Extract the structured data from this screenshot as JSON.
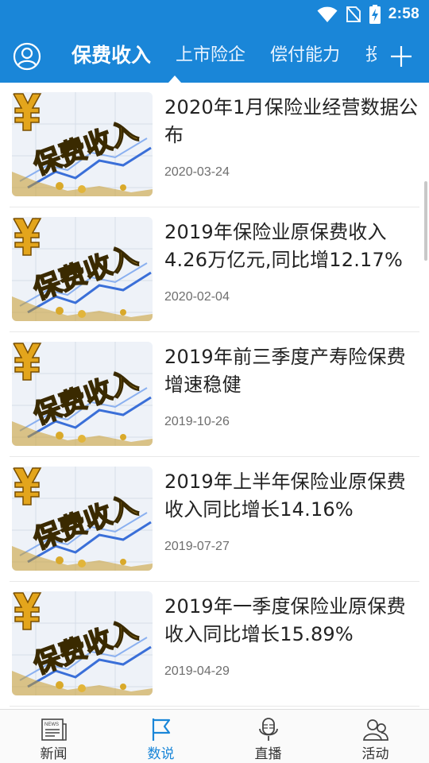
{
  "status_bar": {
    "time": "2:58"
  },
  "header": {
    "tabs": [
      {
        "label": "保费收入",
        "active": true
      },
      {
        "label": "上市险企",
        "active": false
      },
      {
        "label": "偿付能力",
        "active": false
      },
      {
        "label": "投",
        "active": false
      }
    ]
  },
  "articles": [
    {
      "title": "2020年1月保险业经营数据公布",
      "date": "2020-03-24",
      "thumb_text": "保费收入"
    },
    {
      "title": "2019年保险业原保费收入4.26万亿元,同比增12.17%",
      "date": "2020-02-04",
      "thumb_text": "保费收入"
    },
    {
      "title": "2019年前三季度产寿险保费增速稳健",
      "date": "2019-10-26",
      "thumb_text": "保费收入"
    },
    {
      "title": "2019年上半年保险业原保费收入同比增长14.16%",
      "date": "2019-07-27",
      "thumb_text": "保费收入"
    },
    {
      "title": "2019年一季度保险业原保费收入同比增长15.89%",
      "date": "2019-04-29",
      "thumb_text": "保费收入"
    }
  ],
  "bottom_nav": [
    {
      "label": "新闻",
      "icon": "newspaper-icon",
      "active": false,
      "icon_text": "NEWS"
    },
    {
      "label": "数说",
      "icon": "flag-icon",
      "active": true
    },
    {
      "label": "直播",
      "icon": "microphone-icon",
      "active": false
    },
    {
      "label": "活动",
      "icon": "people-icon",
      "active": false
    }
  ],
  "colors": {
    "brand": "#1a86d8",
    "active_nav": "#1a86d8",
    "text": "#222222",
    "date": "#6e6e6e"
  }
}
